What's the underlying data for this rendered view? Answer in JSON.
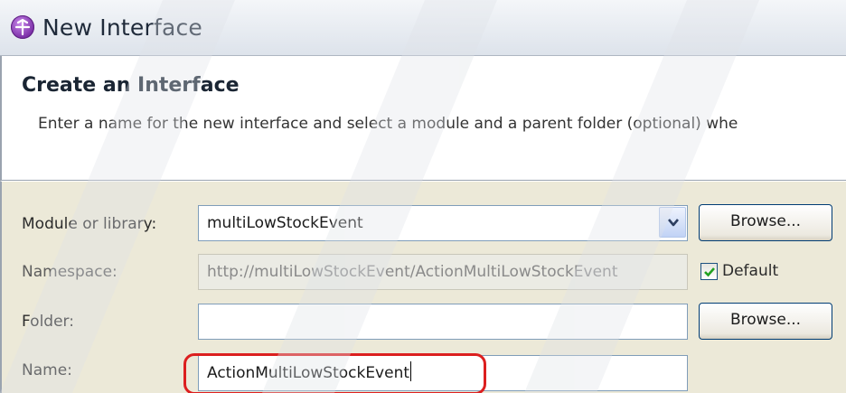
{
  "window": {
    "title": "New Interface",
    "app_icon": "wid-interface-icon"
  },
  "header": {
    "title": "Create an Interface",
    "description": "Enter a name for the new interface and select a module and a parent folder (optional) whe"
  },
  "form": {
    "module": {
      "label": "Module or library:",
      "value": "multiLowStockEvent",
      "browse_label": "Browse..."
    },
    "namespace": {
      "label": "Namespace:",
      "value": "http://multiLowStockEvent/ActionMultiLowStockEvent",
      "default_label": "Default",
      "default_checked": true
    },
    "folder": {
      "label": "Folder:",
      "value": "",
      "browse_label": "Browse..."
    },
    "name": {
      "label": "Name:",
      "value": "ActionMultiLowStockEvent"
    }
  },
  "colors": {
    "highlight": "#dc1f1f",
    "checkmark": "#21a121"
  }
}
